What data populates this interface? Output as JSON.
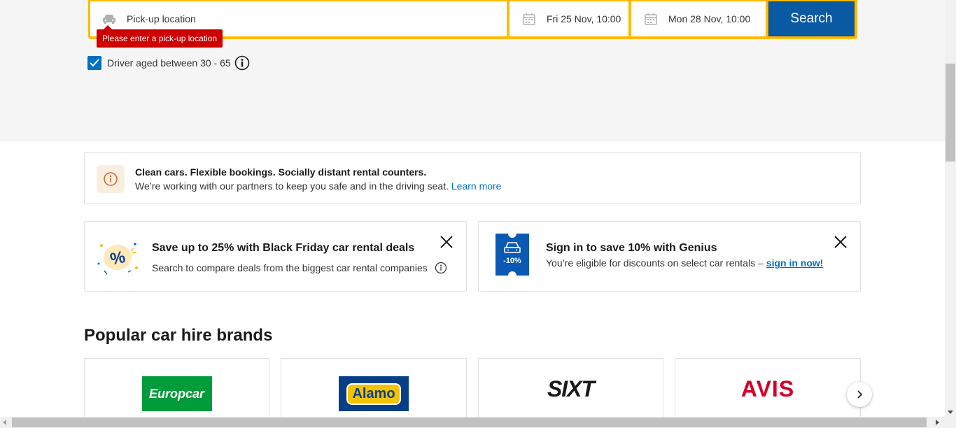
{
  "search": {
    "pickup_placeholder": "Pick-up location",
    "pickup_date": "Fri 25 Nov, 10:00",
    "dropoff_date": "Mon 28 Nov, 10:00",
    "search_label": "Search",
    "error_tooltip": "Please enter a pick-up location",
    "driver_age_label": "Driver aged between 30 - 65",
    "driver_age_checked": true
  },
  "notice": {
    "title": "Clean cars. Flexible bookings. Socially distant rental counters.",
    "text": "We’re working with our partners to keep you safe and in the driving seat.",
    "link": "Learn more"
  },
  "promos": [
    {
      "title": "Save up to 25% with Black Friday car rental deals",
      "text": "Search to compare deals from the biggest car rental companies"
    },
    {
      "title": "Sign in to save 10% with Genius",
      "text": "You’re eligible for discounts on select car rentals –",
      "link": "sign in now!",
      "badge": "-10%"
    }
  ],
  "brands": {
    "heading": "Popular car hire brands",
    "items": [
      "Europcar",
      "Alamo",
      "SIXT",
      "AVIS"
    ]
  },
  "colors": {
    "accent_yellow": "#febb02",
    "search_blue": "#0a59a3",
    "error_red": "#cc0000",
    "link_blue": "#0071c2"
  }
}
